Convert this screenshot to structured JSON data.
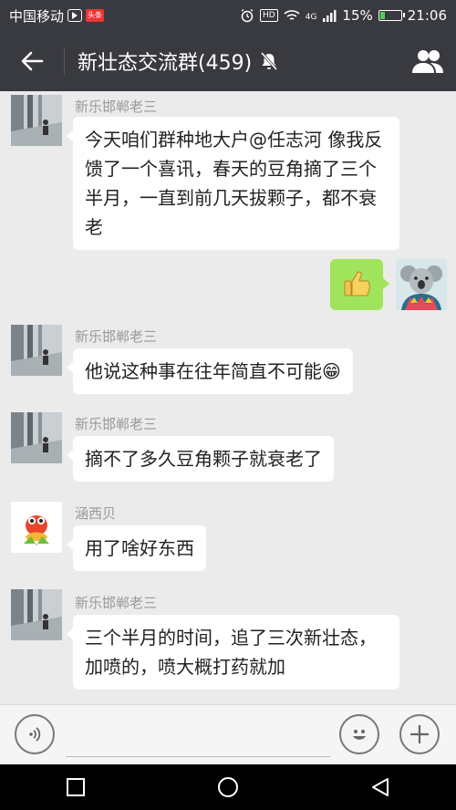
{
  "status_bar": {
    "carrier": "中国移动",
    "toutiao_badge": "头条",
    "hd_badge": "HD",
    "network": "4G",
    "battery": "15%",
    "time": "21:06",
    "battery_level": 0.15
  },
  "header": {
    "title": "新壮态交流群(459)"
  },
  "messages": [
    {
      "sender": "新乐邯郸老三",
      "text": "今天咱们群种地大户@任志河 像我反馈了一个喜讯，春天的豆角摘了三个半月，一直到前几天拔颗子，都不衰老"
    },
    {
      "sender": "me",
      "sticker": "thumbs-up"
    },
    {
      "sender": "新乐邯郸老三",
      "text": "他说这种事在往年简直不可能😁"
    },
    {
      "sender": "新乐邯郸老三",
      "text": "摘不了多久豆角颗子就衰老了"
    },
    {
      "sender": "涵西贝",
      "text": "用了啥好东西"
    },
    {
      "sender": "新乐邯郸老三",
      "text": "三个半月的时间，追了三次新壮态，加喷的，喷大概打药就加"
    }
  ],
  "colors": {
    "header_bg": "#393a3f",
    "chat_bg": "#ebebeb",
    "my_bubble": "#9fe45b"
  },
  "icons": [
    "back-arrow-icon",
    "mute-bell-icon",
    "members-icon",
    "voice-icon",
    "emoji-icon",
    "plus-icon",
    "nav-square-icon",
    "nav-circle-icon",
    "nav-triangle-icon"
  ]
}
